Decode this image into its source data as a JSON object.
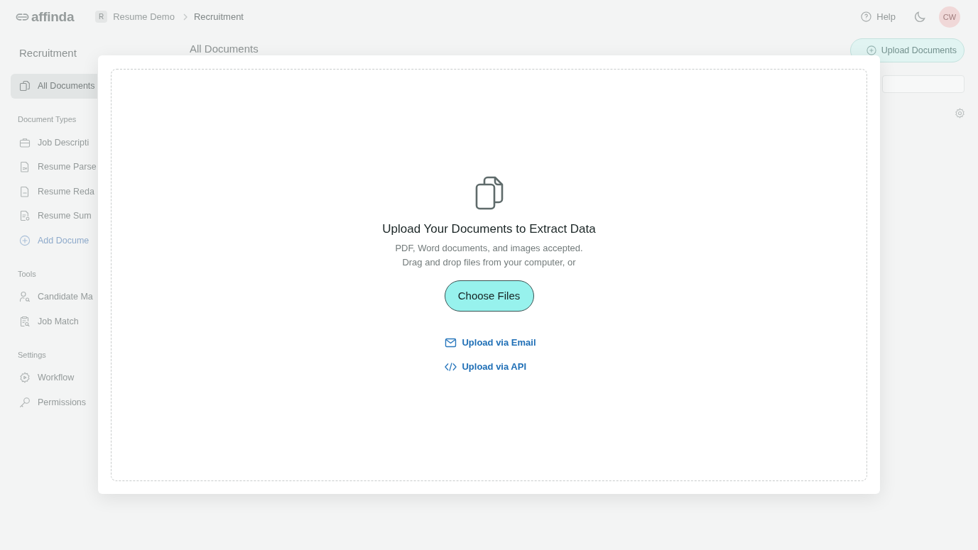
{
  "header": {
    "logo": "affinda",
    "workspace_badge": "R",
    "breadcrumb": [
      {
        "label": "Resume Demo",
        "selected": false
      },
      {
        "label": "Recruitment",
        "selected": true
      }
    ],
    "help": "Help",
    "avatar": "CW"
  },
  "sidebar": {
    "title": "Recruitment",
    "sections": [
      {
        "items": [
          {
            "label": "All Documents",
            "kind": "nav",
            "selected": true
          }
        ]
      },
      {
        "heading": "Document Types",
        "items": [
          {
            "label": "Job Descripti",
            "kind": "nav",
            "selected": false
          },
          {
            "label": "Resume Parse",
            "kind": "nav",
            "selected": false
          },
          {
            "label": "Resume Reda",
            "kind": "nav",
            "selected": false
          },
          {
            "label": "Resume Sum",
            "kind": "nav",
            "selected": false
          },
          {
            "label": "Add Docume",
            "kind": "action",
            "selected": false
          }
        ]
      },
      {
        "heading": "Tools",
        "items": [
          {
            "label": "Candidate Ma",
            "kind": "nav",
            "selected": false
          },
          {
            "label": "Job Match",
            "kind": "nav",
            "selected": false
          }
        ]
      },
      {
        "heading": "Settings",
        "items": [
          {
            "label": "Workflow",
            "kind": "nav",
            "selected": false
          },
          {
            "label": "Permissions",
            "kind": "nav",
            "selected": false
          }
        ]
      }
    ]
  },
  "main": {
    "title": "All Documents",
    "upload_button": "Upload Documents"
  },
  "upload_dialog": {
    "title": "Upload Your Documents to Extract Data",
    "description": [
      "PDF, Word documents, and images accepted.",
      "Drag and drop files from your computer, or"
    ],
    "choose_button": "Choose Files",
    "links": [
      {
        "label": "Upload via Email",
        "kind": "email"
      },
      {
        "label": "Upload via API",
        "kind": "api"
      }
    ]
  }
}
